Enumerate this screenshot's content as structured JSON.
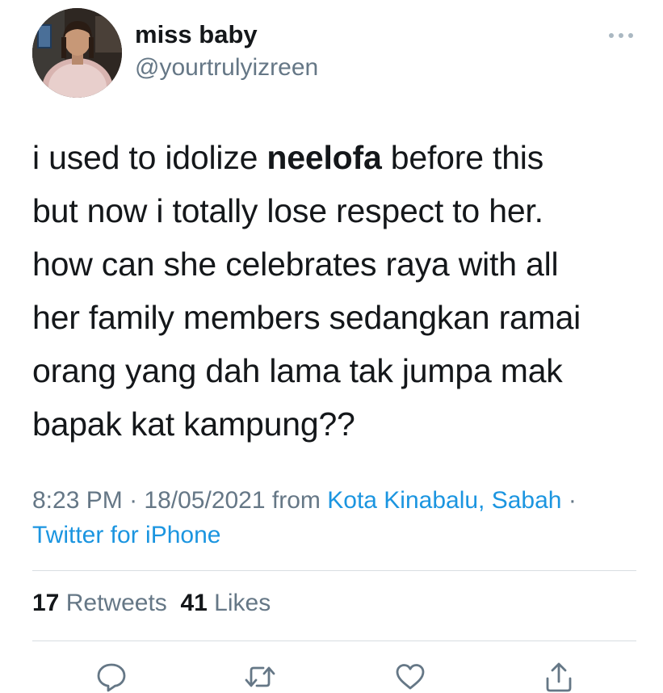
{
  "user": {
    "display_name": "miss baby",
    "handle": "@yourtrulyizreen",
    "avatar_icon": "profile-photo"
  },
  "tweet": {
    "lines": [
      [
        "i used to idolize ",
        "neelofa",
        " before this"
      ],
      "but now i totally lose respect to her.",
      "how can she celebrates raya with all",
      "her family members sedangkan ramai",
      "orang yang dah lama tak jumpa mak",
      "bapak kat kampung??"
    ]
  },
  "meta": {
    "time": "8:23 PM",
    "separator": " · ",
    "date": "18/05/2021",
    "from_label": "from",
    "location": "Kota Kinabalu, Sabah",
    "separator2": " ·",
    "source": "Twitter for iPhone"
  },
  "stats": {
    "retweets_count": "17",
    "retweets_label": "Retweets",
    "likes_count": "41",
    "likes_label": "Likes"
  },
  "actions": {
    "reply_icon": "reply-icon",
    "retweet_icon": "retweet-icon",
    "like_icon": "heart-icon",
    "share_icon": "share-icon"
  },
  "colors": {
    "text": "#14171a",
    "secondary": "#657786",
    "link": "#1b95e0",
    "divider": "#d8dde1"
  }
}
